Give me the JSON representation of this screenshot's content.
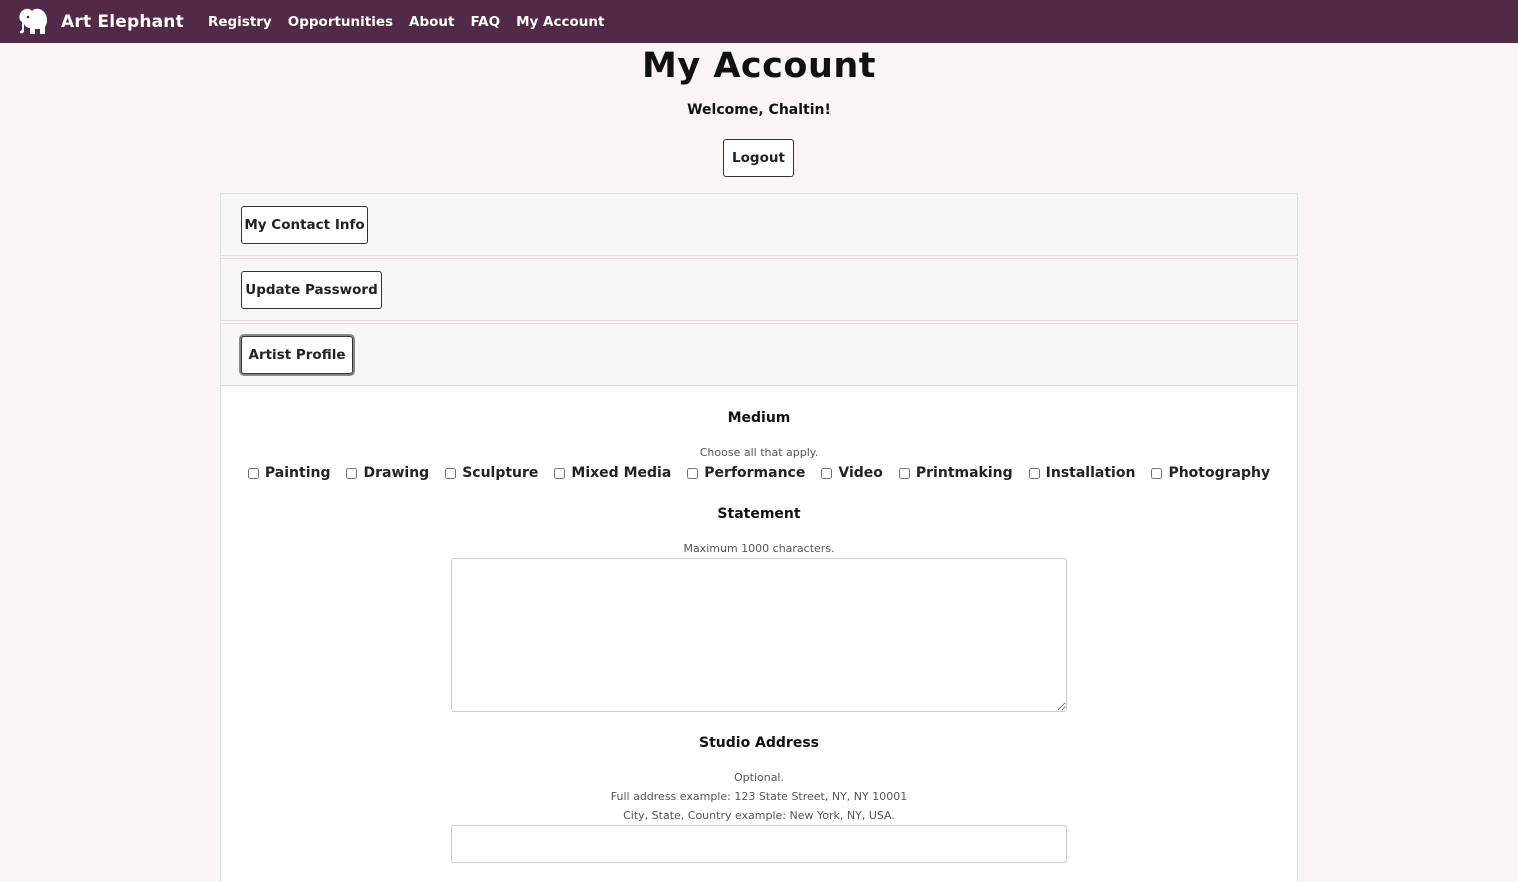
{
  "nav": {
    "brand": "Art Elephant",
    "logo_icon": "elephant-icon",
    "bg_color": "#522947",
    "links": [
      "Registry",
      "Opportunities",
      "About",
      "FAQ",
      "My Account"
    ]
  },
  "page": {
    "title": "My Account",
    "welcome": "Welcome, Chaltin!",
    "logout_label": "Logout"
  },
  "panels": {
    "contact_label": "My Contact Info",
    "password_label": "Update Password",
    "artist_label": "Artist Profile"
  },
  "profile": {
    "medium": {
      "label": "Medium",
      "help": "Choose all that apply.",
      "options": [
        "Painting",
        "Drawing",
        "Sculpture",
        "Mixed Media",
        "Performance",
        "Video",
        "Printmaking",
        "Installation",
        "Photography"
      ]
    },
    "statement": {
      "label": "Statement",
      "help": "Maximum 1000 characters.",
      "value": ""
    },
    "studio": {
      "label": "Studio Address",
      "help1": "Optional.",
      "help2": "Full address example: 123 State Street, NY, NY 10001",
      "help3": "City, State, Country example: New York, NY, USA.",
      "value": ""
    }
  }
}
